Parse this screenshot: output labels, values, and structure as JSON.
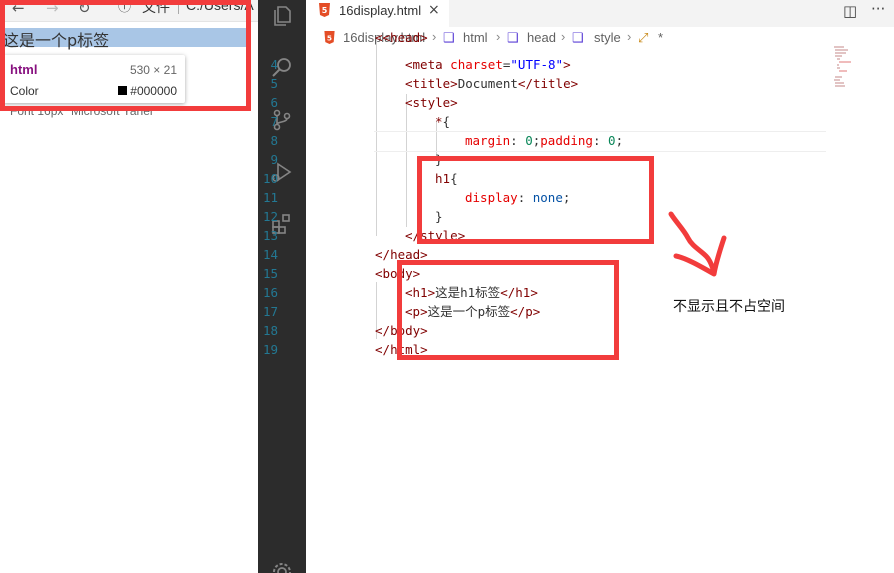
{
  "browser": {
    "address_prefix": "文件",
    "address_path": "C:/Users/A",
    "page_text": "这是一个p标签",
    "inspector": {
      "tag": "html",
      "dimensions": "530 × 21",
      "color_label": "Color",
      "color_value": "#000000",
      "font_line": "Font 16px \"Microsoft Yahei\""
    }
  },
  "editor": {
    "tab_label": "16display.html",
    "breadcrumbs": [
      "16display.html",
      "html",
      "head",
      "style",
      "*"
    ],
    "lines": [
      {
        "n": "4"
      },
      {
        "n": "5"
      },
      {
        "n": "6"
      },
      {
        "n": "7"
      },
      {
        "n": "8"
      },
      {
        "n": "9"
      },
      {
        "n": "10"
      },
      {
        "n": "11"
      },
      {
        "n": "12"
      },
      {
        "n": "13"
      },
      {
        "n": "14"
      },
      {
        "n": "15"
      },
      {
        "n": "16"
      },
      {
        "n": "17"
      },
      {
        "n": "18"
      },
      {
        "n": "19"
      }
    ],
    "code": {
      "l3": "<head>",
      "l4_tag": "meta",
      "l4_attr": "charset",
      "l4_val": "\"UTF-8\"",
      "l5_tag": "title",
      "l5_text": "Document",
      "l6_tag": "style",
      "l7_sel": "*",
      "l8_p1": "margin",
      "l8_v1": "0",
      "l8_p2": "padding",
      "l8_v2": "0",
      "l10_sel": "h1",
      "l11_prop": "display",
      "l11_val": "none",
      "l13_tag": "style",
      "l14_tag": "head",
      "l15_tag": "body",
      "l16_tag": "h1",
      "l16_text": "这是h1标签",
      "l17_tag": "p",
      "l17_text": "这是一个p标签",
      "l18_tag": "body",
      "l19_tag": "html"
    }
  },
  "annotation": {
    "note": "不显示且不占空间",
    "color": "#f23c3c"
  }
}
